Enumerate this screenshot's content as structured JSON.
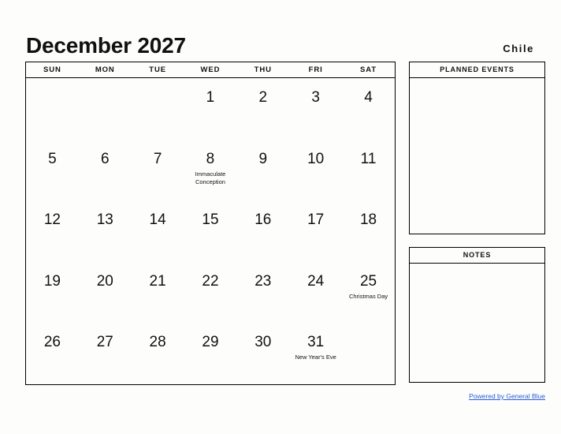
{
  "header": {
    "month_title": "December 2027",
    "country": "Chile"
  },
  "calendar": {
    "weekday_headers": [
      "SUN",
      "MON",
      "TUE",
      "WED",
      "THU",
      "FRI",
      "SAT"
    ],
    "weeks": [
      [
        {
          "day": "",
          "event": ""
        },
        {
          "day": "",
          "event": ""
        },
        {
          "day": "",
          "event": ""
        },
        {
          "day": "1",
          "event": ""
        },
        {
          "day": "2",
          "event": ""
        },
        {
          "day": "3",
          "event": ""
        },
        {
          "day": "4",
          "event": ""
        }
      ],
      [
        {
          "day": "5",
          "event": ""
        },
        {
          "day": "6",
          "event": ""
        },
        {
          "day": "7",
          "event": ""
        },
        {
          "day": "8",
          "event": "Immaculate Conception"
        },
        {
          "day": "9",
          "event": ""
        },
        {
          "day": "10",
          "event": ""
        },
        {
          "day": "11",
          "event": ""
        }
      ],
      [
        {
          "day": "12",
          "event": ""
        },
        {
          "day": "13",
          "event": ""
        },
        {
          "day": "14",
          "event": ""
        },
        {
          "day": "15",
          "event": ""
        },
        {
          "day": "16",
          "event": ""
        },
        {
          "day": "17",
          "event": ""
        },
        {
          "day": "18",
          "event": ""
        }
      ],
      [
        {
          "day": "19",
          "event": ""
        },
        {
          "day": "20",
          "event": ""
        },
        {
          "day": "21",
          "event": ""
        },
        {
          "day": "22",
          "event": ""
        },
        {
          "day": "23",
          "event": ""
        },
        {
          "day": "24",
          "event": ""
        },
        {
          "day": "25",
          "event": "Christmas Day"
        }
      ],
      [
        {
          "day": "26",
          "event": ""
        },
        {
          "day": "27",
          "event": ""
        },
        {
          "day": "28",
          "event": ""
        },
        {
          "day": "29",
          "event": ""
        },
        {
          "day": "30",
          "event": ""
        },
        {
          "day": "31",
          "event": "New Year's Eve"
        },
        {
          "day": "",
          "event": ""
        }
      ]
    ]
  },
  "panels": {
    "planned_events": {
      "title": "PLANNED EVENTS",
      "content": ""
    },
    "notes": {
      "title": "NOTES",
      "content": ""
    }
  },
  "footer": {
    "link_text": "Powered by General Blue",
    "link_color": "#2a5bd7"
  }
}
